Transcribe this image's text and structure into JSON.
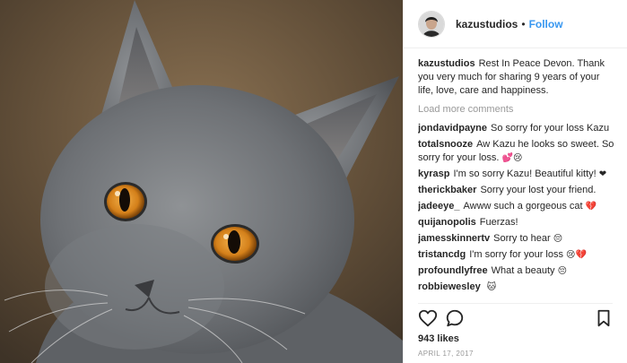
{
  "header": {
    "username": "kazustudios",
    "separator": "•",
    "follow_label": "Follow"
  },
  "caption": {
    "username": "kazustudios",
    "text": "Rest In Peace Devon. Thank you very much for sharing 9 years of your life, love, care and happiness."
  },
  "load_more_label": "Load more comments",
  "comments": [
    {
      "username": "jondavidpayne",
      "text": "So sorry for your loss Kazu",
      "emoji": ""
    },
    {
      "username": "totalsnooze",
      "text": "Aw Kazu he looks so sweet. So sorry for your loss.",
      "emoji": "💕😢"
    },
    {
      "username": "kyrasp",
      "text": "I'm so sorry Kazu! Beautiful kitty!",
      "emoji": "❤"
    },
    {
      "username": "therickbaker",
      "text": "Sorry your lost your friend.",
      "emoji": ""
    },
    {
      "username": "jadeeye_",
      "text": "Awww such a gorgeous cat",
      "emoji": "💔"
    },
    {
      "username": "quijanopolis",
      "text": "Fuerzas!",
      "emoji": ""
    },
    {
      "username": "jamesskinnertv",
      "text": "Sorry to hear",
      "emoji": "😔"
    },
    {
      "username": "tristancdg",
      "text": "I'm sorry for your loss",
      "emoji": "😢💔"
    },
    {
      "username": "profoundlyfree",
      "text": "What a beauty",
      "emoji": "😔"
    },
    {
      "username": "robbiewesley",
      "text": "",
      "emoji": "🐱"
    }
  ],
  "likes_text": "943 likes",
  "date_text": "APRIL 17, 2017",
  "icons": {
    "like": "heart-icon",
    "comment": "comment-bubble-icon",
    "save": "bookmark-icon"
  },
  "colors": {
    "link": "#3897f0",
    "text": "#262626",
    "muted": "#999999",
    "cat_eye": "#d4801a"
  }
}
